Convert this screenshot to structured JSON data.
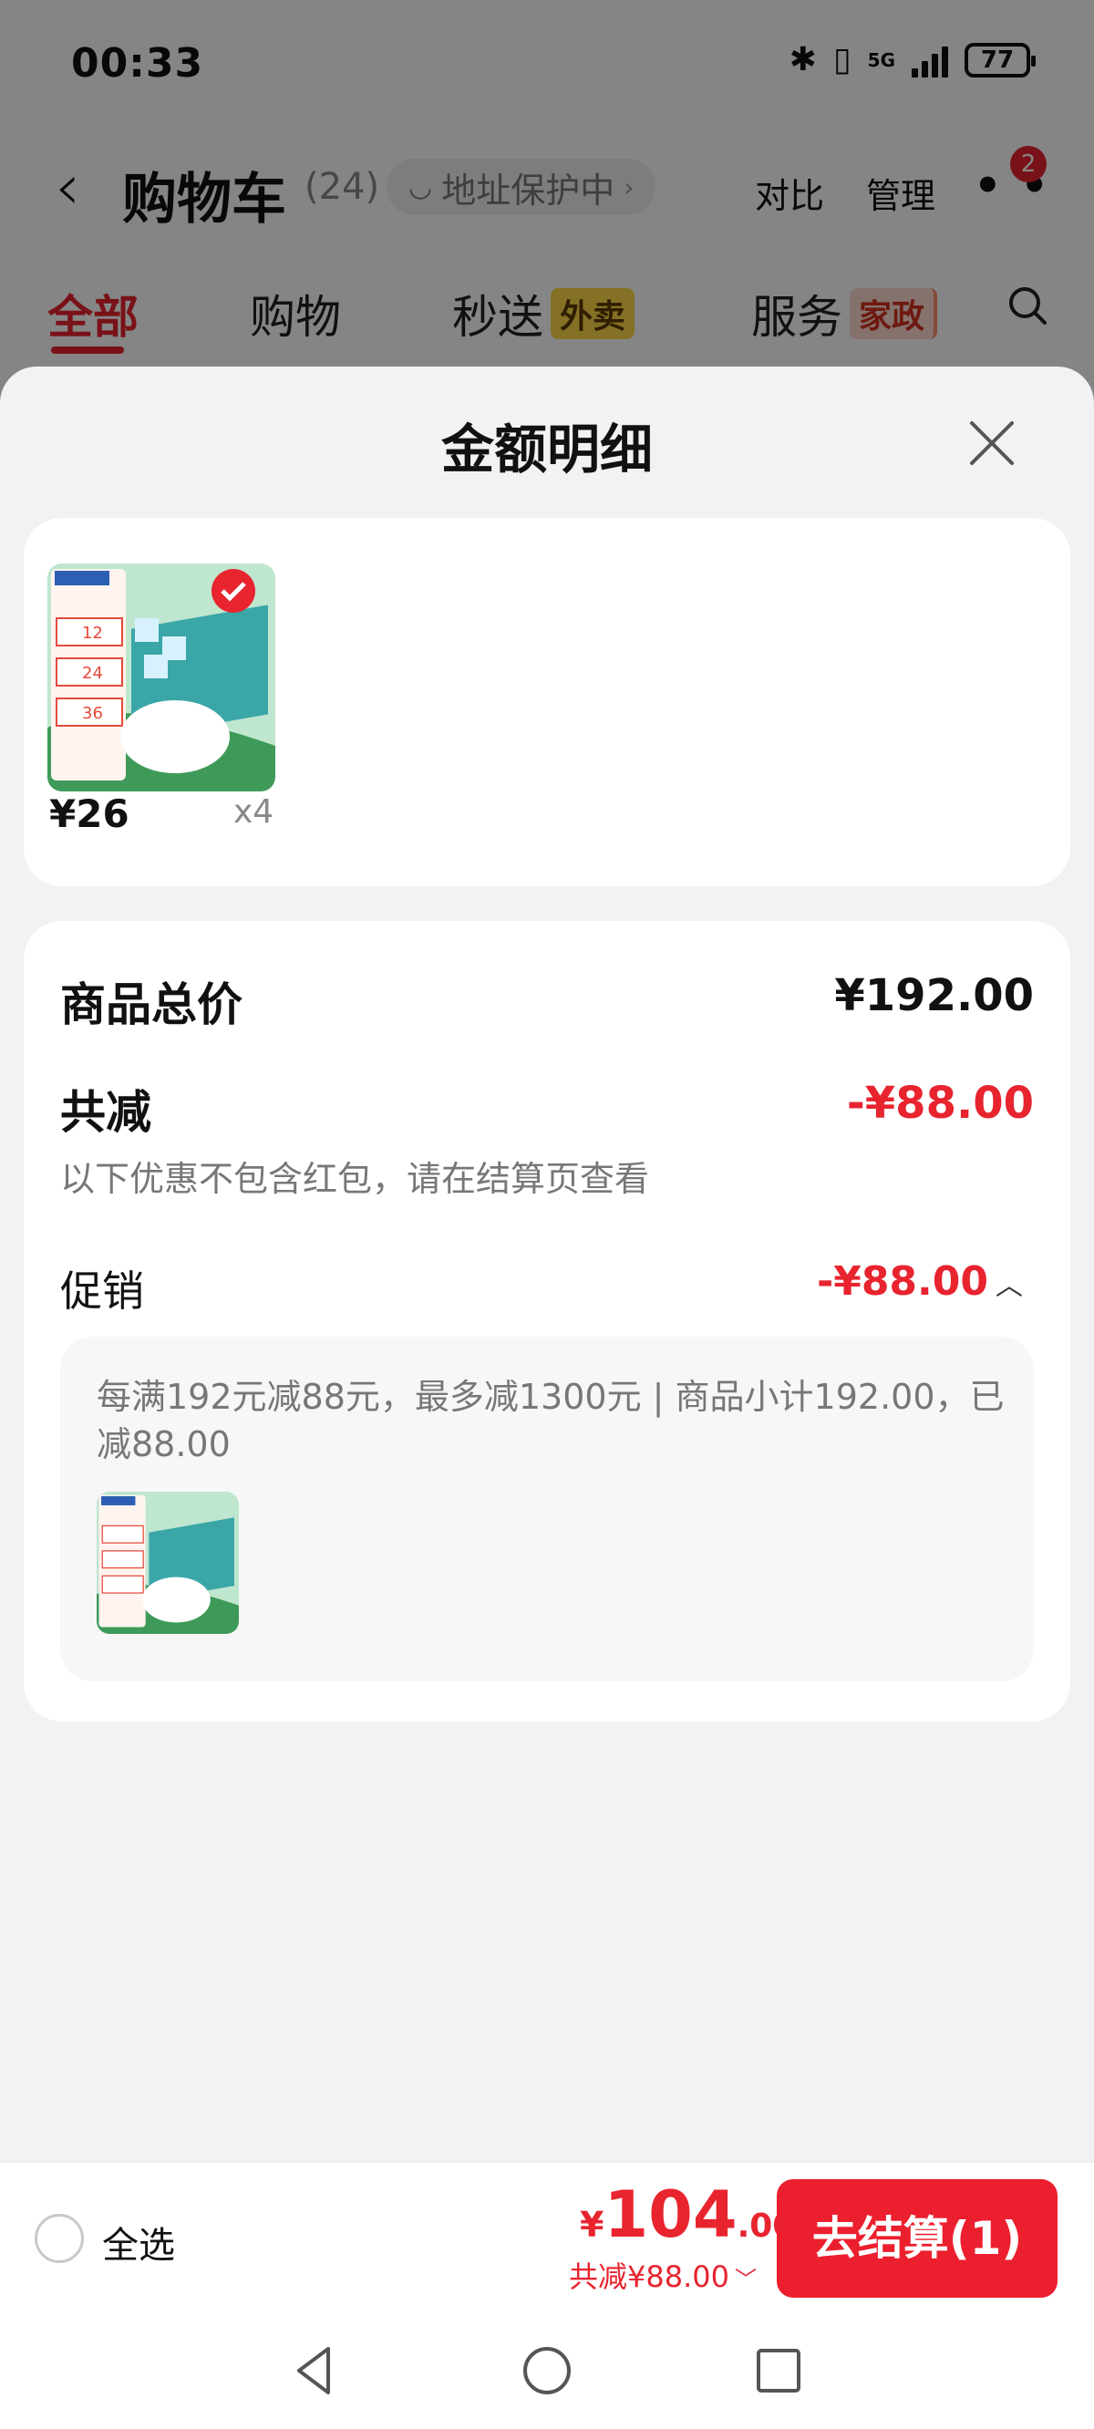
{
  "status": {
    "time": "00:33",
    "network": "5G",
    "battery": "77"
  },
  "header": {
    "title": "购物车",
    "count": "(24)",
    "address_pill": "地址保护中",
    "compare": "对比",
    "manage": "管理",
    "badge": "2"
  },
  "tabs": [
    {
      "label": "全部"
    },
    {
      "label": "购物"
    },
    {
      "label": "秒送",
      "tag": "外卖"
    },
    {
      "label": "服务",
      "tag": "家政"
    }
  ],
  "sheet": {
    "title": "金额明细",
    "product": {
      "price": "¥26",
      "qty": "x4"
    },
    "rows": {
      "total_label": "商品总价",
      "total_value": "¥192.00",
      "discount_label": "共减",
      "discount_value": "-¥88.00",
      "note": "以下优惠不包含红包，请在结算页查看",
      "promo_label": "促销",
      "promo_value": "-¥88.00",
      "promo_desc": "每满192元减88元，最多减1300元 | 商品小计192.00，已减88.00"
    }
  },
  "bottom": {
    "select_all": "全选",
    "currency": "¥",
    "total_int": "104",
    "total_dec": ".00",
    "saving": "共减¥88.00",
    "checkout": "去结算(1)"
  },
  "colors": {
    "accent": "#e8242f",
    "checkout_bg": "#ec1f2e"
  },
  "icons": [
    "back-icon",
    "more-icon",
    "search-icon",
    "close-icon",
    "check-icon",
    "chevron-down-icon",
    "triangle-back-icon",
    "circle-home-icon",
    "square-recents-icon"
  ]
}
